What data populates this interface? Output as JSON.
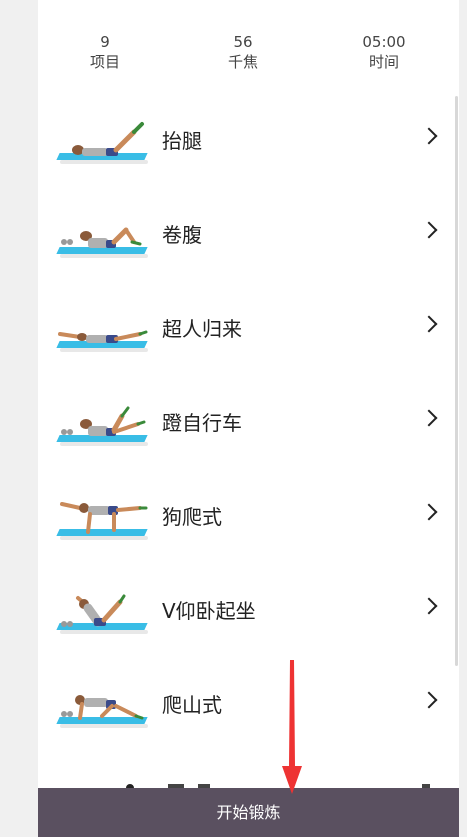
{
  "stats": [
    {
      "value": "9",
      "label": "项目"
    },
    {
      "value": "56",
      "label": "千焦"
    },
    {
      "value": "05:00",
      "label": "时间"
    }
  ],
  "exercises": [
    {
      "name": "抬腿",
      "icon": "leg-raise-figure"
    },
    {
      "name": "卷腹",
      "icon": "crunch-figure"
    },
    {
      "name": "超人归来",
      "icon": "superman-figure"
    },
    {
      "name": "蹬自行车",
      "icon": "bicycle-crunch-figure"
    },
    {
      "name": "狗爬式",
      "icon": "bird-dog-figure"
    },
    {
      "name": "V仰卧起坐",
      "icon": "v-sit-up-figure"
    },
    {
      "name": "爬山式",
      "icon": "mountain-climber-figure"
    }
  ],
  "bottom_button": {
    "label": "开始锻炼"
  },
  "colors": {
    "bottom_bar": "#5a5060",
    "mat": "#39bde6",
    "annotation_arrow": "#ee3333"
  }
}
